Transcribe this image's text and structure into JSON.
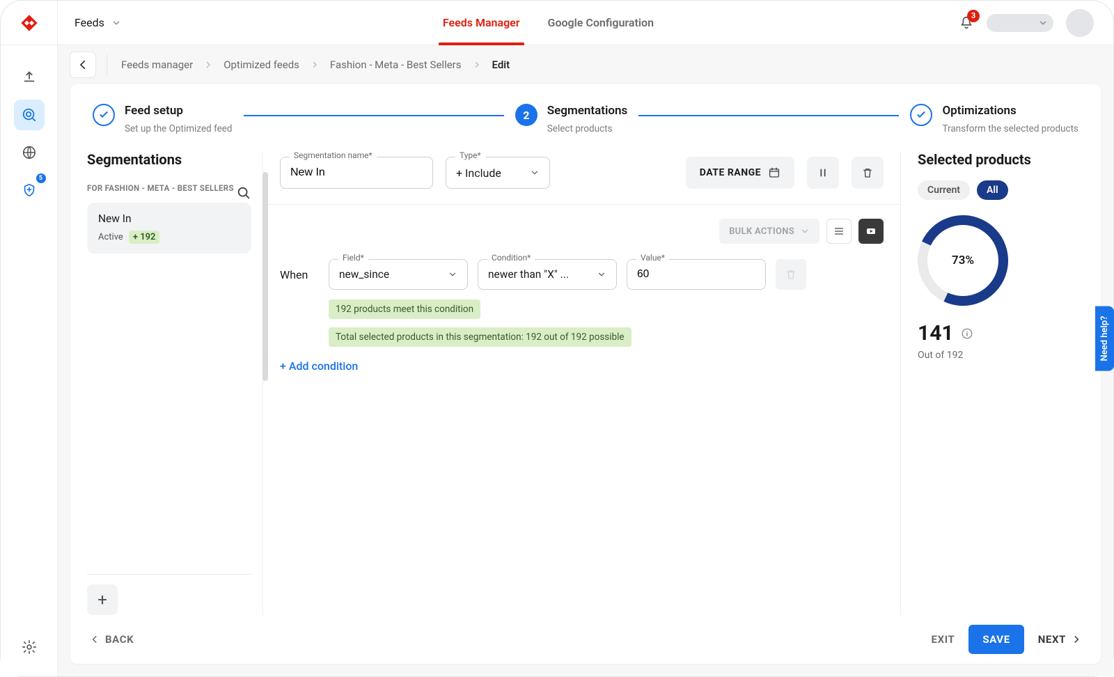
{
  "topbar": {
    "feeds_label": "Feeds",
    "tabs": {
      "feeds_manager": "Feeds Manager",
      "google_config": "Google Configuration"
    },
    "notif_count": "3"
  },
  "leftnav": {
    "shield_badge": "5"
  },
  "breadcrumb": {
    "items": [
      "Feeds manager",
      "Optimized feeds",
      "Fashion - Meta - Best Sellers"
    ],
    "current": "Edit"
  },
  "steps": {
    "s1": {
      "title": "Feed setup",
      "sub": "Set up the Optimized feed"
    },
    "s2": {
      "num": "2",
      "title": "Segmentations",
      "sub": "Select products"
    },
    "s3": {
      "title": "Optimizations",
      "sub": "Transform the selected products"
    }
  },
  "seg_panel": {
    "title": "Segmentations",
    "subtitle": "FOR FASHION - META - BEST SELLERS",
    "items": [
      {
        "name": "New In",
        "status": "Active",
        "count": "+ 192"
      }
    ]
  },
  "editor": {
    "name_label": "Segmentation name*",
    "name_value": "New In",
    "type_label": "Type*",
    "type_value": "+ Include",
    "date_range_label": "DATE RANGE",
    "bulk_label": "BULK ACTIONS",
    "when_label": "When",
    "rule": {
      "field_label": "Field*",
      "field_value": "new_since",
      "cond_label": "Condition*",
      "cond_value": "newer than \"X\" ...",
      "value_label": "Value*",
      "value_value": "60"
    },
    "meet_text": "192 products meet this condition",
    "total_text": "Total selected products in this segmentation: 192 out of 192 possible",
    "add_cond": "+ Add condition"
  },
  "right": {
    "title": "Selected products",
    "pill_current": "Current",
    "pill_all": "All",
    "pct": "73%",
    "count": "141",
    "out_of": "Out of 192"
  },
  "footer": {
    "back": "BACK",
    "exit": "EXIT",
    "save": "SAVE",
    "next": "NEXT"
  },
  "help_tab": "Need help?"
}
